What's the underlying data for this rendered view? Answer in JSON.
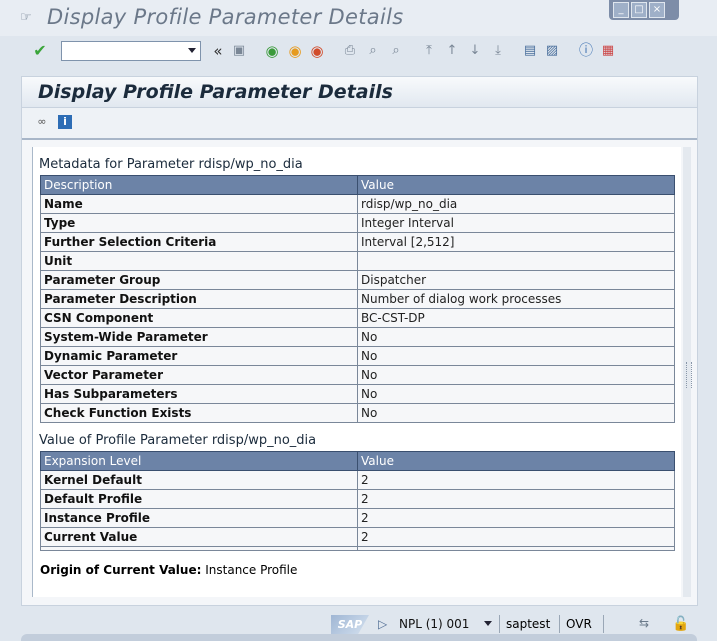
{
  "window": {
    "title": "Display Profile Parameter Details"
  },
  "toolbar": {
    "command_field_value": "",
    "icons": [
      "enter-icon",
      "back-arrows-icon",
      "save-icon",
      "back-icon",
      "exit-icon",
      "cancel-icon",
      "print-icon",
      "find-icon",
      "find-next-icon",
      "first-page-icon",
      "previous-page-icon",
      "next-page-icon",
      "last-page-icon",
      "create-session-icon",
      "shortcut-icon",
      "help-icon",
      "layout-menu-icon"
    ]
  },
  "panel": {
    "title": "Display Profile Parameter Details",
    "tools": [
      "glasses-icon",
      "info-icon"
    ]
  },
  "metadata": {
    "title": "Metadata for Parameter rdisp/wp_no_dia",
    "headers": [
      "Description",
      "Value"
    ],
    "rows": [
      {
        "key": "Name",
        "value": "rdisp/wp_no_dia"
      },
      {
        "key": "Type",
        "value": "Integer Interval"
      },
      {
        "key": "Further Selection Criteria",
        "value": "Interval [2,512]"
      },
      {
        "key": "Unit",
        "value": ""
      },
      {
        "key": "Parameter Group",
        "value": "Dispatcher"
      },
      {
        "key": "Parameter Description",
        "value": "Number of dialog work processes"
      },
      {
        "key": "CSN Component",
        "value": "BC-CST-DP"
      },
      {
        "key": "System-Wide Parameter",
        "value": "No"
      },
      {
        "key": "Dynamic Parameter",
        "value": "No"
      },
      {
        "key": "Vector Parameter",
        "value": "No"
      },
      {
        "key": "Has Subparameters",
        "value": "No"
      },
      {
        "key": "Check Function Exists",
        "value": "No"
      }
    ]
  },
  "values": {
    "title": "Value of Profile Parameter rdisp/wp_no_dia",
    "headers": [
      "Expansion Level",
      "Value"
    ],
    "rows": [
      {
        "key": "Kernel Default",
        "value": "2"
      },
      {
        "key": "Default Profile",
        "value": "2"
      },
      {
        "key": "Instance Profile",
        "value": "2"
      },
      {
        "key": "Current Value",
        "value": "2"
      }
    ]
  },
  "origin": {
    "label": "Origin of Current Value:",
    "value": "Instance Profile"
  },
  "status": {
    "logo": "SAP",
    "system": "NPL (1) 001",
    "host": "saptest",
    "mode": "OVR"
  }
}
